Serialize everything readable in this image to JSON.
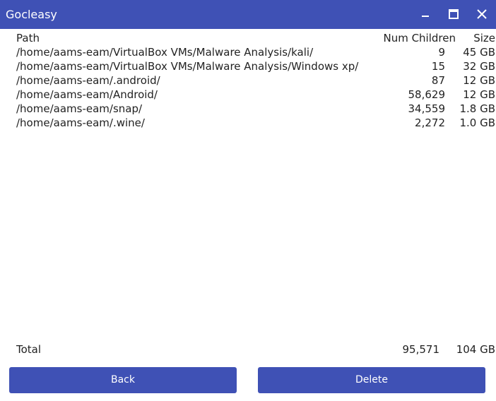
{
  "window": {
    "title": "Gocleasy"
  },
  "table": {
    "headers": {
      "path": "Path",
      "children": "Num Children",
      "size": "Size"
    },
    "rows": [
      {
        "path": "/home/aams-eam/VirtualBox VMs/Malware Analysis/kali/",
        "children": "9",
        "size": "45 GB"
      },
      {
        "path": "/home/aams-eam/VirtualBox VMs/Malware Analysis/Windows xp/",
        "children": "15",
        "size": "32 GB"
      },
      {
        "path": "/home/aams-eam/.android/",
        "children": "87",
        "size": "12 GB"
      },
      {
        "path": "/home/aams-eam/Android/",
        "children": "58,629",
        "size": "12 GB"
      },
      {
        "path": "/home/aams-eam/snap/",
        "children": "34,559",
        "size": "1.8 GB"
      },
      {
        "path": "/home/aams-eam/.wine/",
        "children": "2,272",
        "size": "1.0 GB"
      }
    ]
  },
  "total": {
    "label": "Total",
    "children": "95,571",
    "size": "104 GB"
  },
  "buttons": {
    "back": "Back",
    "delete": "Delete"
  },
  "colors": {
    "accent": "#3f51b5",
    "text": "#222222"
  },
  "icons": {
    "minimize": "minimize-icon",
    "maximize": "maximize-icon",
    "close": "close-icon"
  }
}
